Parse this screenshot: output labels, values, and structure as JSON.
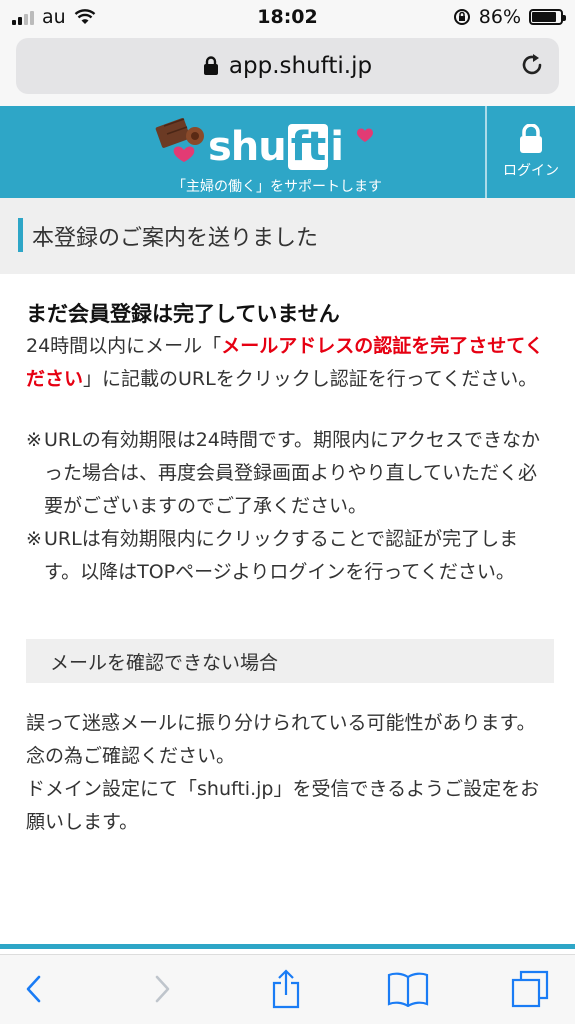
{
  "status_bar": {
    "carrier": "au",
    "time": "18:02",
    "battery": "86%",
    "battery_level": 0.86
  },
  "browser": {
    "url": "app.shufti.jp"
  },
  "site_header": {
    "logo_text": "shufti",
    "tagline": "「主婦の働く」をサポートします",
    "login_label": "ログイン"
  },
  "section": {
    "title": "本登録のご案内を送りました"
  },
  "content": {
    "lead": "まだ会員登録は完了していません",
    "body_prefix": "24時間以内にメール「",
    "body_highlight": "メールアドレスの認証を完了させてください",
    "body_suffix": "」に記載のURLをクリックし認証を行ってください。",
    "notes": [
      {
        "mark": "※",
        "text": "URLの有効期限は24時間です。期限内にアクセスできなかった場合は、再度会員登録画面よりやり直していただく必要がございますのでご了承ください。"
      },
      {
        "mark": "※",
        "text": "URLは有効期限内にクリックすることで認証が完了します。以降はTOPページよりログインを行ってください。"
      }
    ],
    "subheading": "メールを確認できない場合",
    "para1": "誤って迷惑メールに振り分けられている可能性があります。念の為ご確認ください。",
    "para2": "ドメイン設定にて「shufti.jp」を受信できるようご設定をお願いします。"
  },
  "colors": {
    "brand": "#2ea6c7",
    "highlight": "#e60012",
    "ios_blue": "#1a7cf5"
  },
  "icons": [
    "lock-icon",
    "reload-icon",
    "back-icon",
    "forward-icon",
    "share-icon",
    "bookmarks-icon",
    "tabs-icon"
  ]
}
